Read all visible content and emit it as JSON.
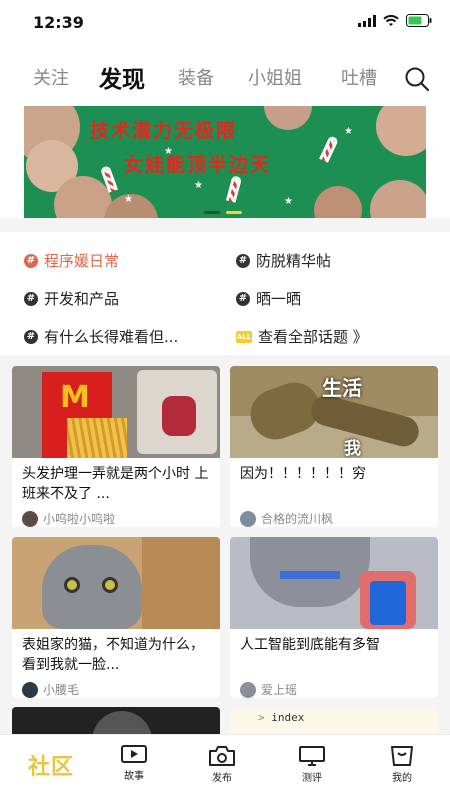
{
  "status": {
    "time": "12:39"
  },
  "tabs": [
    {
      "label": "关注"
    },
    {
      "label": "发现"
    },
    {
      "label": "装备"
    },
    {
      "label": "小姐姐"
    },
    {
      "label": "吐槽"
    }
  ],
  "banner": {
    "line1": "技术潜力无极限",
    "line2": "女娃能顶半边天"
  },
  "topics": [
    {
      "label": "程序媛日常"
    },
    {
      "label": "防脱精华帖"
    },
    {
      "label": "开发和产品"
    },
    {
      "label": "晒一晒"
    },
    {
      "label": "有什么长得难看但..."
    },
    {
      "label": "查看全部话题 》",
      "badge": "ALL"
    }
  ],
  "cards": [
    {
      "title": "头发护理一弄就是两个小时 上班来不及了 ...",
      "author": "小呜啦小呜啦",
      "overlay": []
    },
    {
      "title": "因为！！！！！！穷",
      "author": "合格的流川枫",
      "overlay": [
        "生活",
        "我"
      ]
    },
    {
      "title": "表姐家的猫，不知道为什么，看到我就一脸...",
      "author": "小腰毛",
      "overlay": []
    },
    {
      "title": "人工智能到底能有多智",
      "author": "爱上瑶",
      "overlay": []
    }
  ],
  "partial_card": {
    "code": "index"
  },
  "nav": {
    "home": "社区",
    "items": [
      {
        "label": "故事",
        "icon": "play-icon"
      },
      {
        "label": "发布",
        "icon": "camera-icon"
      },
      {
        "label": "测评",
        "icon": "monitor-icon"
      },
      {
        "label": "我的",
        "icon": "profile-icon"
      }
    ]
  },
  "colors": {
    "accent": "#f6cc2a",
    "hot_topic": "#e2664c",
    "banner_green": "#1d8f52",
    "banner_text": "#e8241e"
  }
}
